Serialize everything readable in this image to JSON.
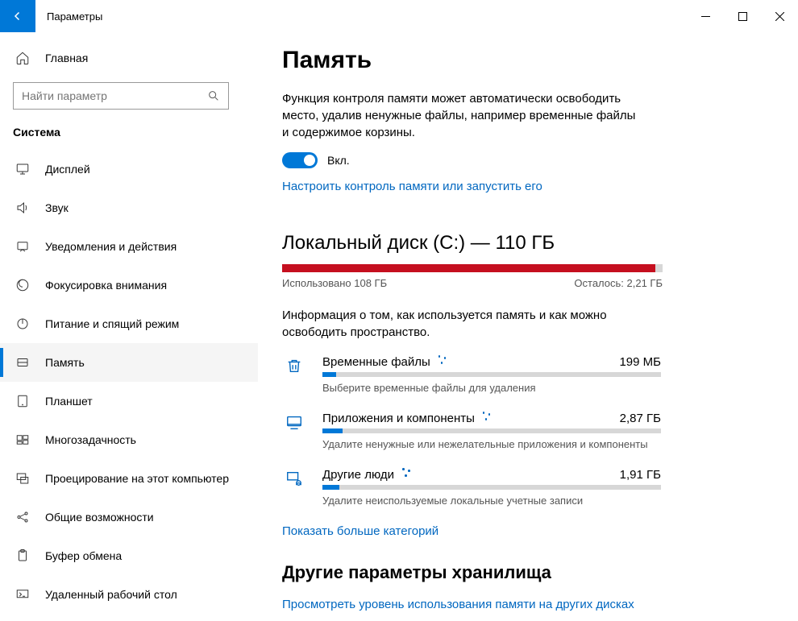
{
  "titlebar": {
    "app_title": "Параметры"
  },
  "sidebar": {
    "home": "Главная",
    "search_placeholder": "Найти параметр",
    "section": "Система",
    "items": [
      {
        "label": "Дисплей",
        "icon": "display"
      },
      {
        "label": "Звук",
        "icon": "sound"
      },
      {
        "label": "Уведомления и действия",
        "icon": "notifications"
      },
      {
        "label": "Фокусировка внимания",
        "icon": "focus"
      },
      {
        "label": "Питание и спящий режим",
        "icon": "power"
      },
      {
        "label": "Память",
        "icon": "storage",
        "selected": true
      },
      {
        "label": "Планшет",
        "icon": "tablet"
      },
      {
        "label": "Многозадачность",
        "icon": "multitask"
      },
      {
        "label": "Проецирование на этот компьютер",
        "icon": "project"
      },
      {
        "label": "Общие возможности",
        "icon": "shared"
      },
      {
        "label": "Буфер обмена",
        "icon": "clipboard"
      },
      {
        "label": "Удаленный рабочий стол",
        "icon": "remote"
      }
    ]
  },
  "main": {
    "title": "Память",
    "storage_sense_desc": "Функция контроля памяти может автоматически освободить место, удалив ненужные файлы, например временные файлы и содержимое корзины.",
    "toggle_label": "Вкл.",
    "configure_link": "Настроить контроль памяти или запустить его",
    "disk_title": "Локальный диск (C:) — 110 ГБ",
    "used_label": "Использовано 108 ГБ",
    "remaining_label": "Осталось: 2,21 ГБ",
    "fill_percent": 98,
    "disk_desc": "Информация о том, как используется память и как можно освободить пространство.",
    "categories": [
      {
        "name": "Временные файлы",
        "size": "199 МБ",
        "hint": "Выберите временные файлы для удаления",
        "fill": 4
      },
      {
        "name": "Приложения и компоненты",
        "size": "2,87 ГБ",
        "hint": "Удалите ненужные или нежелательные приложения и компоненты",
        "fill": 6
      },
      {
        "name": "Другие люди",
        "size": "1,91 ГБ",
        "hint": "Удалите неиспользуемые локальные учетные записи",
        "fill": 5
      }
    ],
    "more_categories_link": "Показать больше категорий",
    "other_storage_heading": "Другие параметры хранилища",
    "view_other_disks_link": "Просмотреть уровень использования памяти на других дисках"
  }
}
